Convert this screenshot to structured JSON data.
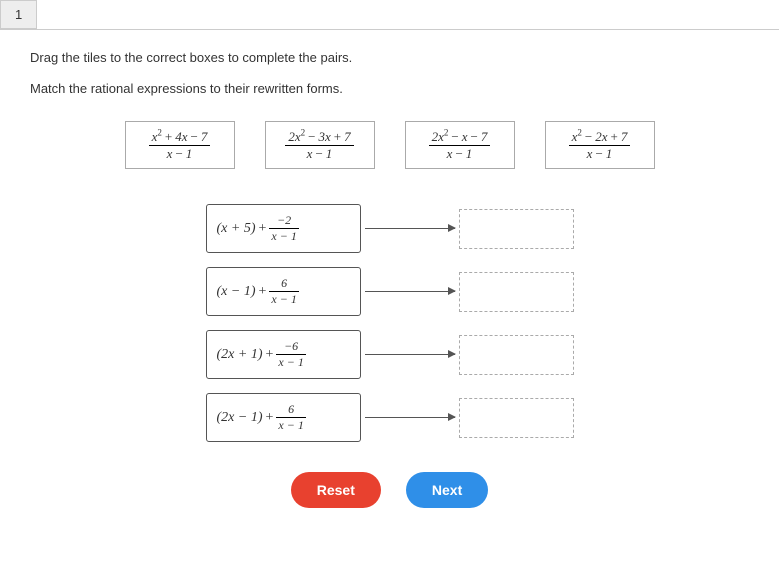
{
  "tab": "1",
  "instruction1": "Drag the tiles to the correct boxes to complete the pairs.",
  "instruction2": "Match the rational expressions to their rewritten forms.",
  "buttons": {
    "reset": "Reset",
    "next": "Next"
  },
  "chart_data": {
    "type": "table",
    "title": "Match rational expressions to rewritten forms",
    "tiles": [
      {
        "numerator": "x² + 4x − 7",
        "denominator": "x − 1"
      },
      {
        "numerator": "2x² − 3x + 7",
        "denominator": "x − 1"
      },
      {
        "numerator": "2x² − x − 7",
        "denominator": "x − 1"
      },
      {
        "numerator": "x² − 2x + 7",
        "denominator": "x − 1"
      }
    ],
    "rewritten_forms": [
      {
        "quotient": "(x + 5)",
        "remainder_num": "−2",
        "remainder_den": "x − 1"
      },
      {
        "quotient": "(x − 1)",
        "remainder_num": "6",
        "remainder_den": "x − 1"
      },
      {
        "quotient": "(2x + 1)",
        "remainder_num": "−6",
        "remainder_den": "x − 1"
      },
      {
        "quotient": "(2x − 1)",
        "remainder_num": "6",
        "remainder_den": "x − 1"
      }
    ]
  }
}
